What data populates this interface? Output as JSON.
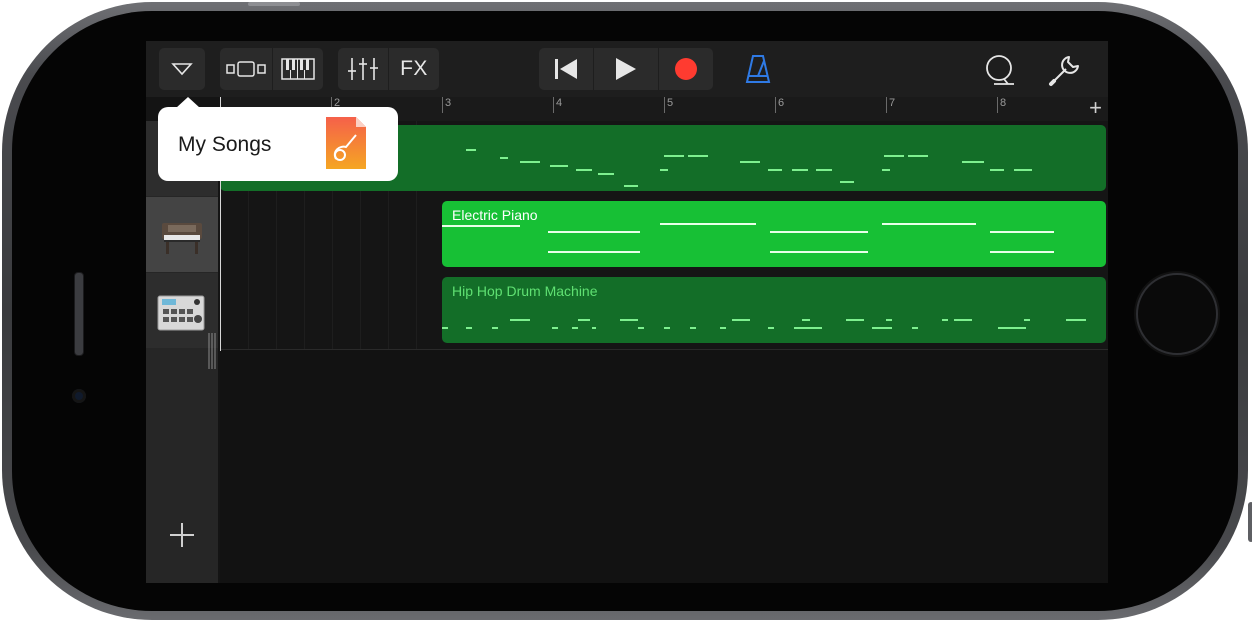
{
  "popover": {
    "label": "My Songs"
  },
  "toolbar": {
    "fx_label": "FX"
  },
  "ruler": {
    "bars": [
      "2",
      "3",
      "4",
      "5",
      "6",
      "7",
      "8"
    ],
    "add_label": "+"
  },
  "tracks": [
    {
      "name": "",
      "region_title": ""
    },
    {
      "name": "",
      "region_title": "Electric Piano"
    },
    {
      "name": "",
      "region_title": "Hip Hop Drum Machine"
    }
  ],
  "add_track_label": "+",
  "colors": {
    "region_bright": "#17c035",
    "region_dark": "#136e28",
    "record": "#ff3b30",
    "metronome": "#2f7ae5"
  },
  "icons": [
    "tracks-dropdown-icon",
    "tracks-view-icon",
    "keyboard-icon",
    "mixer-icon",
    "rewind-icon",
    "play-icon",
    "record-icon",
    "metronome-icon",
    "loop-browser-icon",
    "settings-wrench-icon",
    "song-document-icon"
  ]
}
